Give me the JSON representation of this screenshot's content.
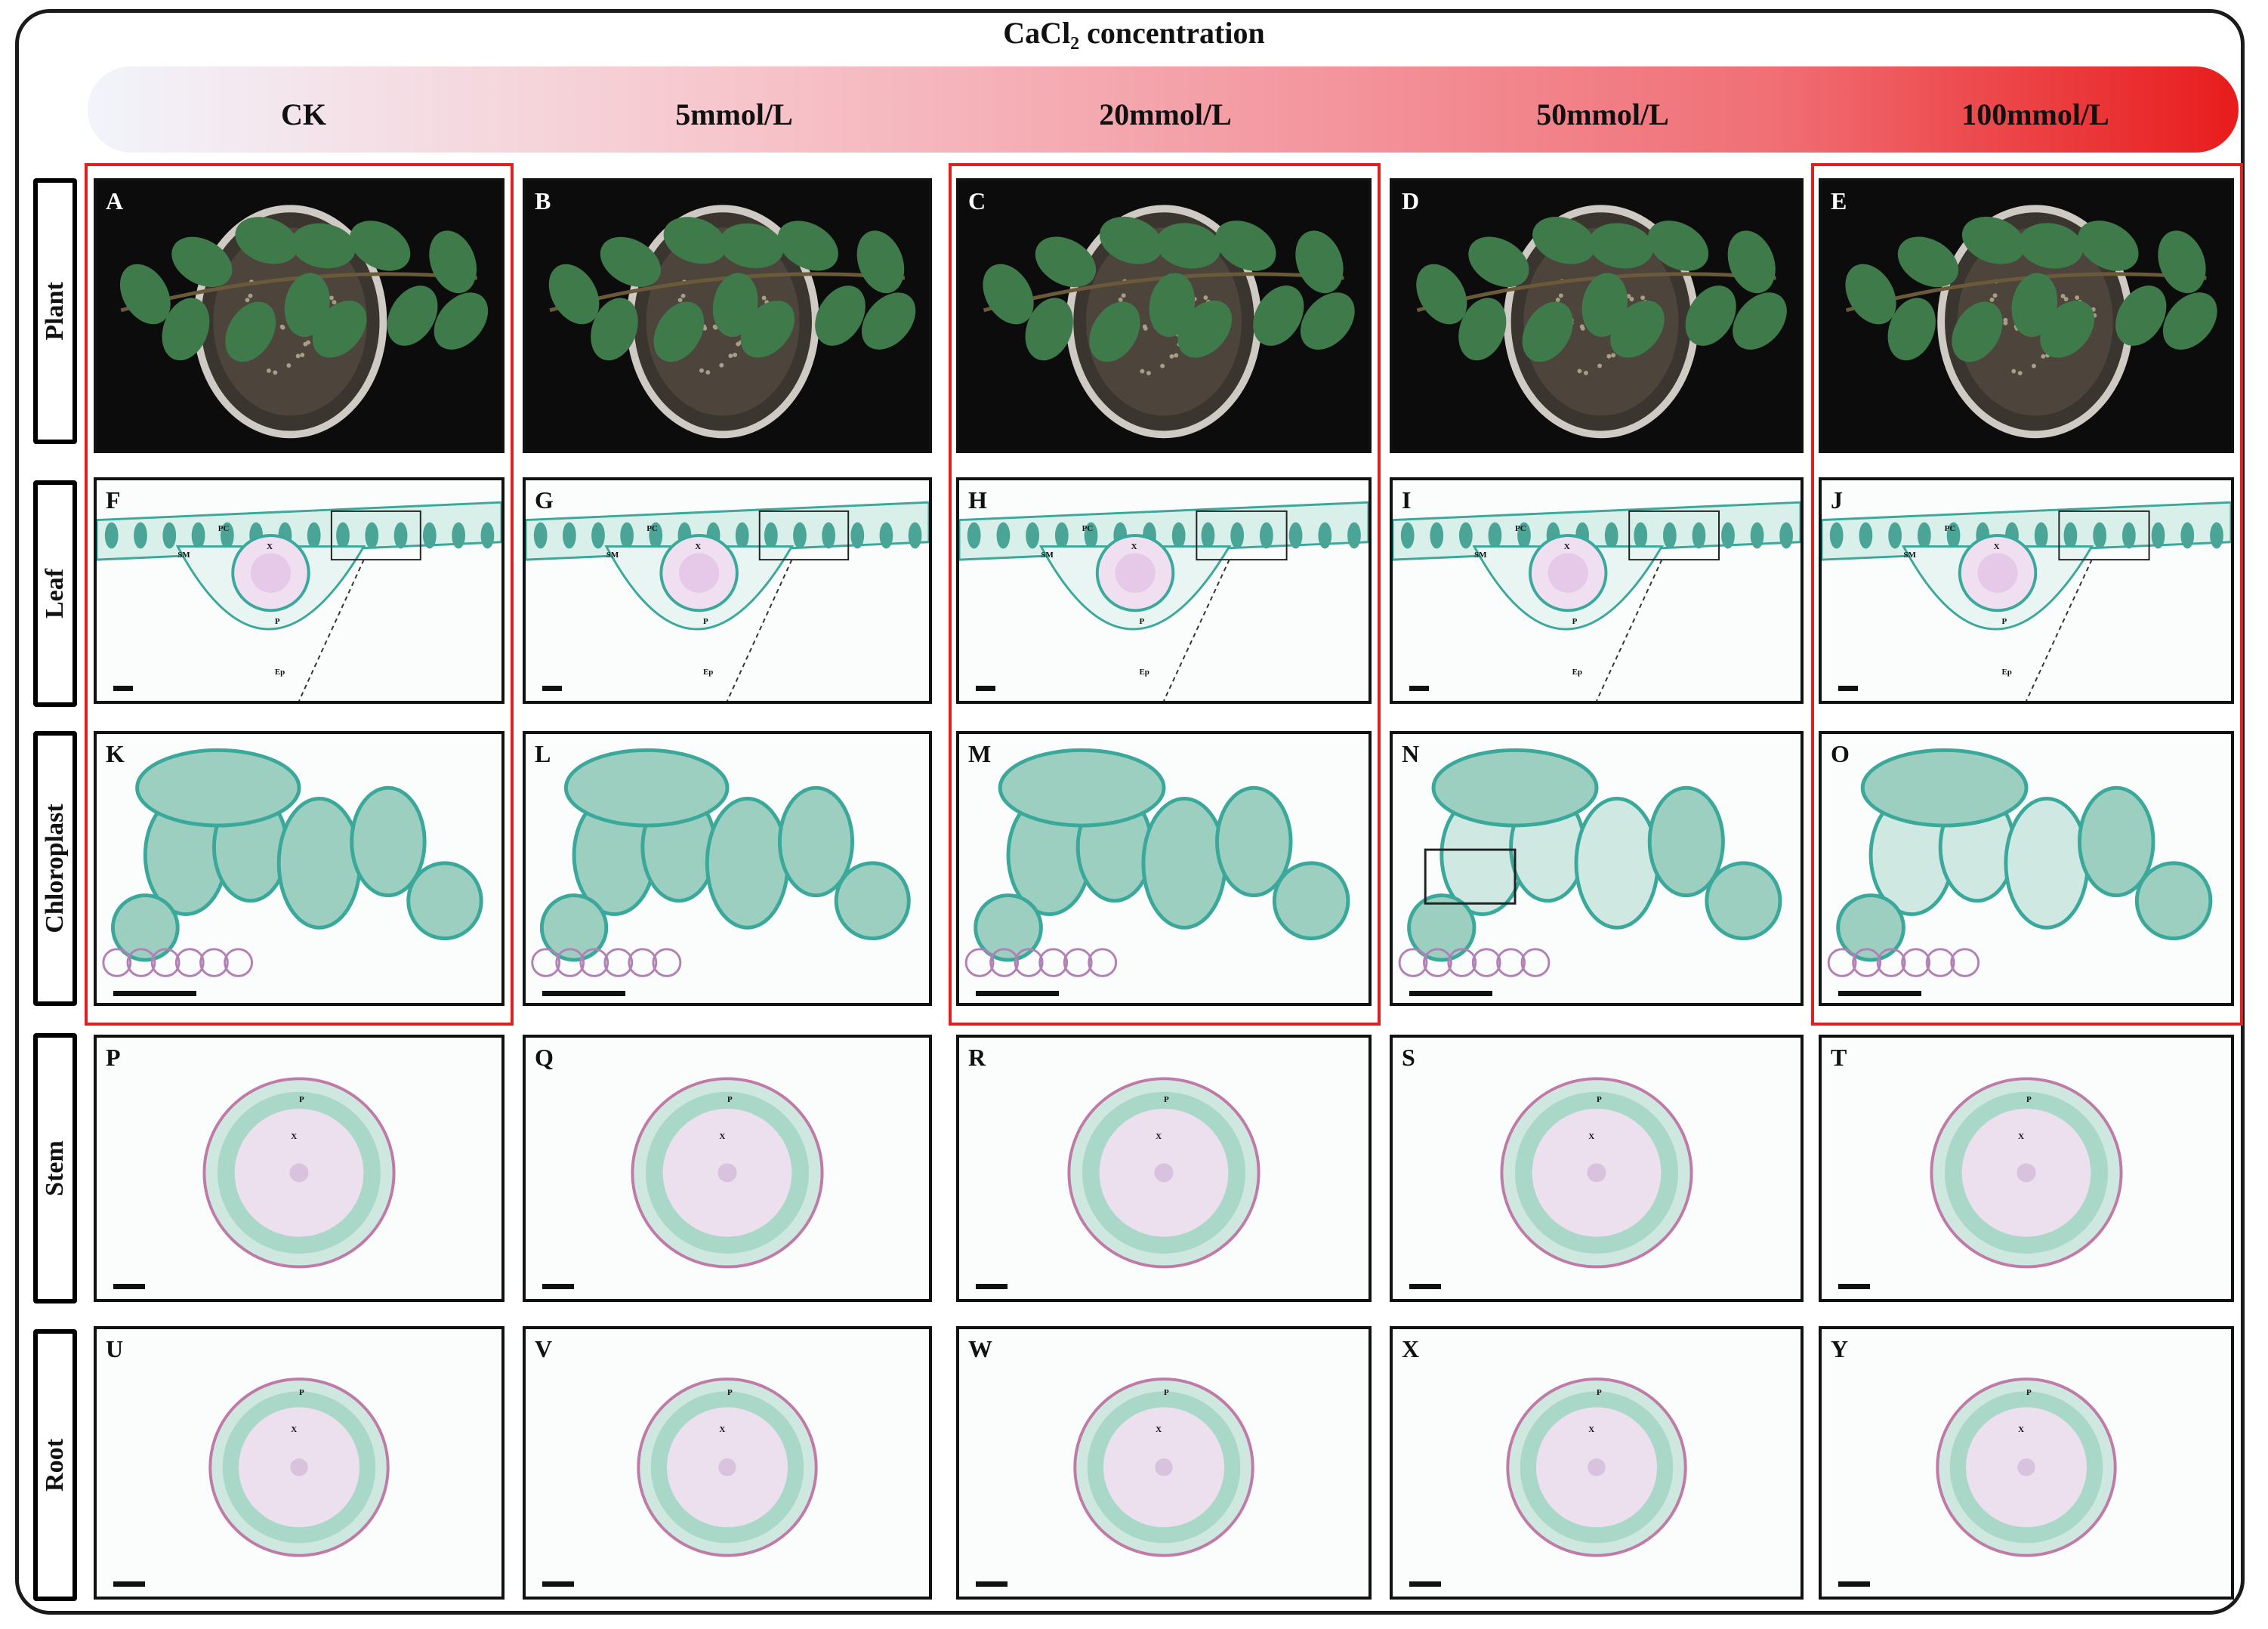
{
  "title": "CaCl₂ concentration",
  "concentrations": [
    "CK",
    "5mmol/L",
    "20mmol/L",
    "50mmol/L",
    "100mmol/L"
  ],
  "rows": [
    {
      "label": "Plant",
      "color": "#1a1a1a"
    },
    {
      "label": "Leaf",
      "color": "#4fb36a"
    },
    {
      "label": "Chloroplast",
      "color": "#6fbf5a"
    },
    {
      "label": "Stem",
      "color": "#d4703a"
    },
    {
      "label": "Root",
      "color": "#c99a27"
    }
  ],
  "panel_letters": {
    "plant": [
      "A",
      "B",
      "C",
      "D",
      "E"
    ],
    "leaf": [
      "F",
      "G",
      "H",
      "I",
      "J"
    ],
    "chloroplast": [
      "K",
      "L",
      "M",
      "N",
      "O"
    ],
    "stem": [
      "P",
      "Q",
      "R",
      "S",
      "T"
    ],
    "root": [
      "U",
      "V",
      "W",
      "X",
      "Y"
    ]
  },
  "leaf_tissue_labels": {
    "pc": "PC",
    "sm": "SM",
    "x": "X",
    "p": "P",
    "ep": "Ep"
  },
  "stem_root_labels": {
    "p": "P",
    "x": "X"
  },
  "highlight_color": "#e02020"
}
